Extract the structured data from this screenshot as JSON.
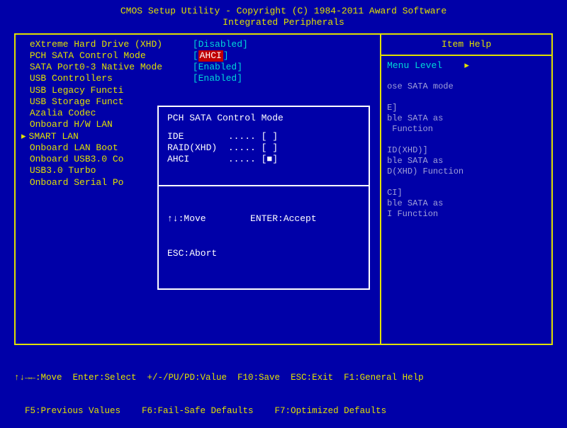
{
  "header": {
    "line1": "CMOS Setup Utility - Copyright (C) 1984-2011 Award Software",
    "line2": "Integrated Peripherals"
  },
  "settings": [
    {
      "label": "eXtreme Hard Drive (XHD)",
      "value": "Disabled",
      "selected": false,
      "cursor": false
    },
    {
      "label": "PCH SATA Control Mode",
      "value": "AHCI",
      "selected": true,
      "cursor": false
    },
    {
      "label": "SATA Port0-3 Native Mode",
      "value": "Enabled",
      "selected": false,
      "cursor": false
    },
    {
      "label": "USB Controllers",
      "value": "Enabled",
      "selected": false,
      "cursor": false
    },
    {
      "label": "USB Legacy Functi",
      "value": "",
      "selected": false,
      "cursor": false
    },
    {
      "label": "USB Storage Funct",
      "value": "",
      "selected": false,
      "cursor": false
    },
    {
      "label": "Azalia Codec",
      "value": "",
      "selected": false,
      "cursor": false
    },
    {
      "label": "Onboard H/W LAN",
      "value": "",
      "selected": false,
      "cursor": false
    },
    {
      "label": "SMART LAN",
      "value": "",
      "selected": false,
      "cursor": true
    },
    {
      "label": "Onboard LAN Boot",
      "value": "",
      "selected": false,
      "cursor": false
    },
    {
      "label": "Onboard USB3.0 Co",
      "value": "",
      "selected": false,
      "cursor": false
    },
    {
      "label": "USB3.0 Turbo",
      "value": "",
      "selected": false,
      "cursor": false
    },
    {
      "label": "Onboard Serial Po",
      "value": "",
      "selected": false,
      "cursor": false
    }
  ],
  "help": {
    "title": "Item Help",
    "menu_level_label": "Menu Level",
    "menu_level_indicator": "▸",
    "body": "ose SATA mode\n\nE]\nble SATA as\n Function\n\nID(XHD)]\nble SATA as\nD(XHD) Function\n\nCI]\nble SATA as\nI Function"
  },
  "popup": {
    "title": "PCH SATA Control Mode",
    "options": [
      {
        "label": "IDE",
        "marker": "[ ]"
      },
      {
        "label": "RAID(XHD)",
        "marker": "[ ]"
      },
      {
        "label": "AHCI",
        "marker": "[■]"
      }
    ],
    "footer_line1": "↑↓:Move        ENTER:Accept",
    "footer_line2": "ESC:Abort"
  },
  "footer": {
    "line1": "↑↓→←:Move  Enter:Select  +/-/PU/PD:Value  F10:Save  ESC:Exit  F1:General Help",
    "line2": "  F5:Previous Values    F6:Fail-Safe Defaults    F7:Optimized Defaults"
  }
}
